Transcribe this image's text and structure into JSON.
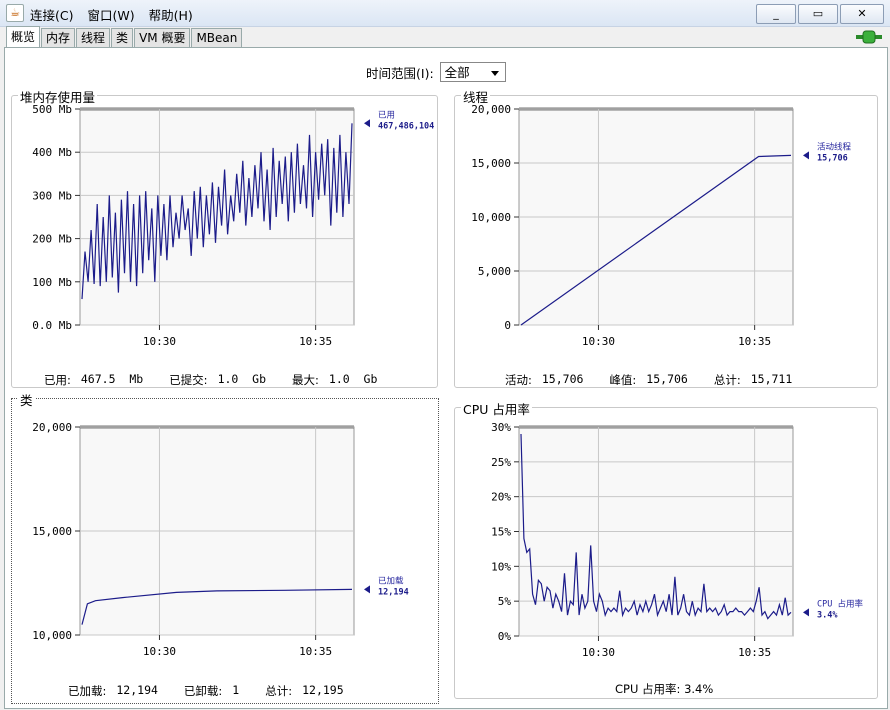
{
  "menu": [
    "连接(C)",
    "窗口(W)",
    "帮助(H)"
  ],
  "window_buttons": {
    "minimize": "_",
    "restore": "▭",
    "close": "✕"
  },
  "tabs": [
    "概览",
    "内存",
    "线程",
    "类",
    "VM 概要",
    "MBean"
  ],
  "active_tab": 0,
  "time_range": {
    "label": "时间范围(I):",
    "value": "全部"
  },
  "panels": {
    "heap": {
      "title": "堆内存使用量",
      "yticks": [
        "0.0 Mb",
        "100 Mb",
        "200 Mb",
        "300 Mb",
        "400 Mb",
        "500 Mb"
      ],
      "xticks": [
        "10:30",
        "10:35"
      ],
      "legend_name": "已用",
      "legend_value": "467,486,104",
      "stats": [
        {
          "label": "已用:",
          "value": "467.5  Mb"
        },
        {
          "label": "已提交:",
          "value": "1.0  Gb"
        },
        {
          "label": "最大:",
          "value": "1.0  Gb"
        }
      ]
    },
    "threads": {
      "title": "线程",
      "yticks": [
        "0",
        "5,000",
        "10,000",
        "15,000",
        "20,000"
      ],
      "xticks": [
        "10:30",
        "10:35"
      ],
      "legend_name": "活动线程",
      "legend_value": "15,706",
      "stats": [
        {
          "label": "活动:",
          "value": "15,706"
        },
        {
          "label": "峰值:",
          "value": "15,706"
        },
        {
          "label": "总计:",
          "value": "15,711"
        }
      ]
    },
    "classes": {
      "title": "类",
      "yticks": [
        "10,000",
        "15,000",
        "20,000"
      ],
      "xticks": [
        "10:30",
        "10:35"
      ],
      "legend_name": "已加载",
      "legend_value": "12,194",
      "stats": [
        {
          "label": "已加载:",
          "value": "12,194"
        },
        {
          "label": "已卸载:",
          "value": "1"
        },
        {
          "label": "总计:",
          "value": "12,195"
        }
      ]
    },
    "cpu": {
      "title": "CPU 占用率",
      "yticks": [
        "0%",
        "5%",
        "10%",
        "15%",
        "20%",
        "25%",
        "30%"
      ],
      "xticks": [
        "10:30",
        "10:35"
      ],
      "legend_name": "CPU 占用率",
      "legend_value": "3.4%",
      "stats_text": "CPU 占用率: 3.4%"
    }
  },
  "chart_data": [
    {
      "type": "line",
      "title": "堆内存使用量",
      "ylim": [
        0,
        500
      ],
      "series": [
        {
          "name": "已用",
          "values": [
            60,
            170,
            100,
            220,
            95,
            280,
            90,
            250,
            100,
            300,
            110,
            260,
            75,
            290,
            120,
            310,
            100,
            280,
            90,
            300,
            120,
            310,
            150,
            270,
            100,
            300,
            160,
            280,
            150,
            300,
            180,
            260,
            200,
            300,
            220,
            270,
            160,
            310,
            200,
            320,
            180,
            300,
            210,
            330,
            190,
            320,
            230,
            360,
            210,
            300,
            240,
            350,
            260,
            380,
            230,
            340,
            250,
            370,
            270,
            400,
            240,
            360,
            220,
            410,
            250,
            380,
            280,
            390,
            240,
            400,
            260,
            420,
            280,
            370,
            270,
            440,
            250,
            400,
            290,
            420,
            300,
            430,
            230,
            410,
            260,
            440,
            250,
            400,
            280,
            467
          ]
        }
      ]
    },
    {
      "type": "line",
      "title": "线程",
      "ylim": [
        0,
        20000
      ],
      "series": [
        {
          "name": "活动线程",
          "x": [
            0,
            0.88,
            1
          ],
          "values": [
            0,
            15600,
            15706
          ]
        }
      ]
    },
    {
      "type": "line",
      "title": "类",
      "ylim": [
        10000,
        20000
      ],
      "series": [
        {
          "name": "已加载",
          "x": [
            0,
            0.02,
            0.05,
            0.15,
            0.35,
            0.5,
            0.75,
            1
          ],
          "values": [
            10500,
            11500,
            11650,
            11800,
            12050,
            12120,
            12150,
            12194
          ]
        }
      ]
    },
    {
      "type": "line",
      "title": "CPU 占用率",
      "ylim": [
        0,
        30
      ],
      "series": [
        {
          "name": "CPU 占用率",
          "values": [
            29,
            14,
            12,
            12.5,
            6,
            4.5,
            8,
            7.5,
            5,
            7,
            6.5,
            4,
            6,
            5,
            3.5,
            9,
            3,
            5,
            4.5,
            12,
            3,
            6,
            4,
            5,
            13,
            5,
            3.5,
            6,
            5,
            3,
            4,
            3.5,
            4,
            3.5,
            6.5,
            3,
            4,
            3.5,
            4,
            5,
            3,
            4.5,
            3.5,
            5,
            3.5,
            4.5,
            6,
            3,
            4,
            5,
            3.5,
            6,
            3,
            8.5,
            3,
            4,
            6,
            3.5,
            3,
            5,
            3,
            4,
            3.5,
            7.5,
            3.5,
            4,
            3.5,
            4,
            3,
            3.5,
            4.5,
            3,
            3.5,
            3.5,
            4,
            3.5,
            3.5,
            3,
            3.5,
            4,
            3.5,
            5,
            7,
            3,
            3.5,
            2.5,
            3,
            3.5,
            3,
            4.5,
            3,
            5.5,
            3,
            3.4
          ]
        }
      ]
    }
  ]
}
